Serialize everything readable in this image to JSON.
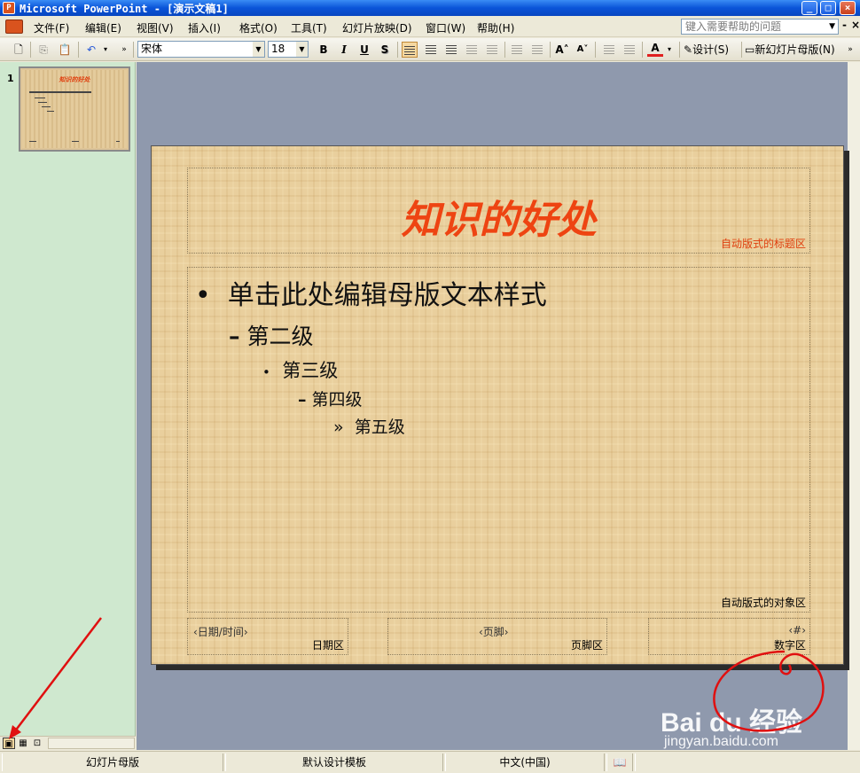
{
  "window": {
    "title": "Microsoft PowerPoint - [演示文稿1]",
    "controls": [
      "_",
      "□",
      "×"
    ]
  },
  "menu": {
    "items": [
      "文件(F)",
      "编辑(E)",
      "视图(V)",
      "插入(I)",
      "格式(O)",
      "工具(T)",
      "幻灯片放映(D)",
      "窗口(W)",
      "帮助(H)"
    ],
    "help_placeholder": "键入需要帮助的问题",
    "doc_controls": [
      "-",
      "×"
    ]
  },
  "toolbar": {
    "font": "宋体",
    "font_size": "18",
    "bold": "B",
    "italic": "I",
    "underline": "U",
    "shadow": "S",
    "font_color": "A",
    "grow_font": "A˄",
    "shrink_font": "A˅",
    "design_label": "设计(S)",
    "new_master_label": "新幻灯片母版(N)"
  },
  "thumbnail": {
    "slide_number": "1",
    "title": "知识的好处"
  },
  "slide": {
    "title": "知识的好处",
    "title_area_label": "自动版式的标题区",
    "body_area_label": "自动版式的对象区",
    "levels": [
      {
        "bullet": "•",
        "text": "单击此处编辑母版文本样式"
      },
      {
        "bullet": "–",
        "text": "第二级"
      },
      {
        "bullet": "•",
        "text": "第三级"
      },
      {
        "bullet": "–",
        "text": "第四级"
      },
      {
        "bullet": "»",
        "text": "第五级"
      }
    ],
    "footer": {
      "date_text": "‹日期/时间›",
      "date_label": "日期区",
      "footer_text": "‹页脚›",
      "footer_label": "页脚区",
      "number_text": "‹#›",
      "number_label": "数字区"
    },
    "title_color": "#ee4412"
  },
  "statusbar": {
    "view": "幻灯片母版",
    "template": "默认设计模板",
    "language": "中文(中国)"
  },
  "watermark": {
    "logo": "Bai du 经验",
    "url": "jingyan.baidu.com"
  }
}
